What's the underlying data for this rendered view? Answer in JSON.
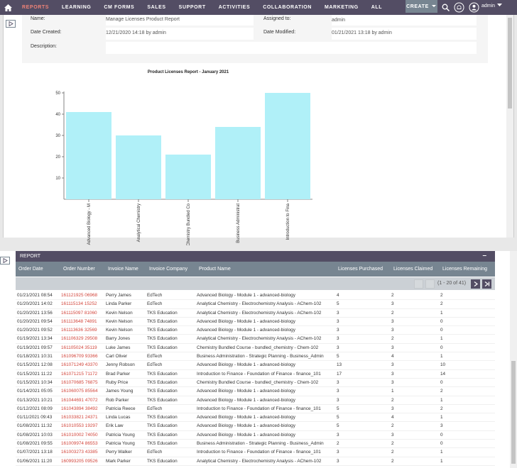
{
  "nav": {
    "items": [
      "REPORTS",
      "LEARNING",
      "CM FORMS",
      "SALES",
      "SUPPORT",
      "ACTIVITIES",
      "COLLABORATION",
      "MARKETING",
      "ALL"
    ],
    "create_label": "CREATE",
    "user": "admin"
  },
  "details": {
    "name_label": "Name:",
    "name_value": "Manage Licenses Product Report",
    "assigned_label": "Assigned to:",
    "assigned_value": "admin",
    "created_label": "Date Created:",
    "created_value": "12/21/2020 14:18 by admin",
    "modified_label": "Date Modified:",
    "modified_value": "01/21/2021 13:18 by admin",
    "description_label": "Description:",
    "description_value": ""
  },
  "chart_data": {
    "type": "bar",
    "title": "Product Licenses Report - January  2021",
    "categories": [
      "Advanced Biology - M",
      "Analytical Chemistry",
      "Chemistry Bundled Co",
      "Business Administrat",
      "Introduction to Fina"
    ],
    "values": [
      41,
      30,
      21,
      34,
      50
    ],
    "ylim": [
      0,
      50
    ],
    "yticks": [
      "10",
      "20",
      "30",
      "40",
      "50"
    ],
    "bar_color": "#b0f0f8",
    "grid": false
  },
  "report": {
    "title": "REPORT",
    "collapse_symbol": "–",
    "columns": [
      "Order Date",
      "Order Number",
      "Invoice Name",
      "Invoice Company",
      "Product Name",
      "Licenses Purchased",
      "Licenses Claimed",
      "Licenses Remaining"
    ],
    "pager_range": "(1 - 20 of 41)",
    "rows": [
      [
        "01/21/2021 08:54",
        "161121925 06968",
        "Perry James",
        "EdTech",
        "Advanced Biology - Module 1 - advanced-biology",
        "4",
        "2",
        "2"
      ],
      [
        "01/20/2021 14:02",
        "161115134 15252",
        "Linda Parker",
        "EdTech",
        "Analytical Chemistry - Electrochemistry Analysis - AChem-102",
        "5",
        "3",
        "2"
      ],
      [
        "01/20/2021 13:56",
        "161115097 81060",
        "Kevin Nelson",
        "TKS Education",
        "Analytical Chemistry - Electrochemistry Analysis - AChem-102",
        "3",
        "2",
        "1"
      ],
      [
        "01/20/2021 09:54",
        "161113648 74891",
        "Kevin Nelson",
        "TKS Education",
        "Advanced Biology - Module 1 - advanced-biology",
        "3",
        "3",
        "0"
      ],
      [
        "01/20/2021 09:52",
        "161113636 32569",
        "Kevin Nelson",
        "TKS Education",
        "Advanced Biology - Module 1 - advanced-biology",
        "3",
        "3",
        "0"
      ],
      [
        "01/19/2021 13:34",
        "161106329 29508",
        "Barry Jones",
        "TKS Education",
        "Analytical Chemistry - Electrochemistry Analysis - AChem-102",
        "3",
        "2",
        "1"
      ],
      [
        "01/19/2021 09:57",
        "161105024 35119",
        "Luke James",
        "TKS Education",
        "Chemistry Bundled Course - bundled_chemistry - Chem-102",
        "3",
        "3",
        "0"
      ],
      [
        "01/18/2021 10:31",
        "161096709 93366",
        "Carl Oliver",
        "EdTech",
        "Business Administration - Strategic Planning - Business_Admin",
        "5",
        "4",
        "1"
      ],
      [
        "01/15/2021 12:08",
        "161071249 43370",
        "Jenny Robson",
        "EdTech",
        "Advanced Biology - Module 1 - advanced-biology",
        "13",
        "3",
        "10"
      ],
      [
        "01/15/2021 11:22",
        "161071215 71172",
        "Brad Parker",
        "TKS Education",
        "Introduction to Finance - Foundation of Finance - finance_101",
        "17",
        "3",
        "14"
      ],
      [
        "01/15/2021 10:34",
        "161070685 76875",
        "Ruby Price",
        "TKS Education",
        "Chemistry Bundled Course - bundled_chemistry - Chem-102",
        "3",
        "3",
        "0"
      ],
      [
        "01/14/2021 05:05",
        "161060075 85564",
        "James Young",
        "TKS Education",
        "Advanced Biology - Module 1 - advanced-biology",
        "3",
        "1",
        "2"
      ],
      [
        "01/13/2021 10:21",
        "161044691 47072",
        "Rob Parker",
        "TKS Education",
        "Advanced Biology - Module 1 - advanced-biology",
        "3",
        "2",
        "1"
      ],
      [
        "01/12/2021 08:09",
        "161043894 38492",
        "Patricia Reece",
        "EdTech",
        "Introduction to Finance - Foundation of Finance - finance_101",
        "5",
        "3",
        "2"
      ],
      [
        "01/11/2021 09:43",
        "161033821 24371",
        "Linda Lucas",
        "TKS Education",
        "Advanced Biology - Module 1 - advanced-biology",
        "5",
        "4",
        "1"
      ],
      [
        "01/08/2021 11:32",
        "161010553 19297",
        "Erik Law",
        "TKS Education",
        "Advanced Biology - Module 1 - advanced-biology",
        "5",
        "2",
        "3"
      ],
      [
        "01/08/2021 10:03",
        "161010002 74050",
        "Patricia Young",
        "TKS Education",
        "Advanced Biology - Module 1 - advanced-biology",
        "3",
        "3",
        "0"
      ],
      [
        "01/08/2021 09:55",
        "161009974 86553",
        "Patricia Young",
        "TKS Education",
        "Business Administration - Strategic Planning - Business_Admin",
        "2",
        "2",
        "0"
      ],
      [
        "01/07/2021 13:18",
        "161003273 43385",
        "Perry Walker",
        "EdTech",
        "Introduction to Finance - Foundation of Finance - finance_101",
        "3",
        "2",
        "1"
      ],
      [
        "01/06/2021 11:20",
        "160993205 09526",
        "Mark Parker",
        "TKS Education",
        "Analytical Chemistry - Electrochemistry Analysis - AChem-102",
        "3",
        "2",
        "1"
      ]
    ]
  }
}
